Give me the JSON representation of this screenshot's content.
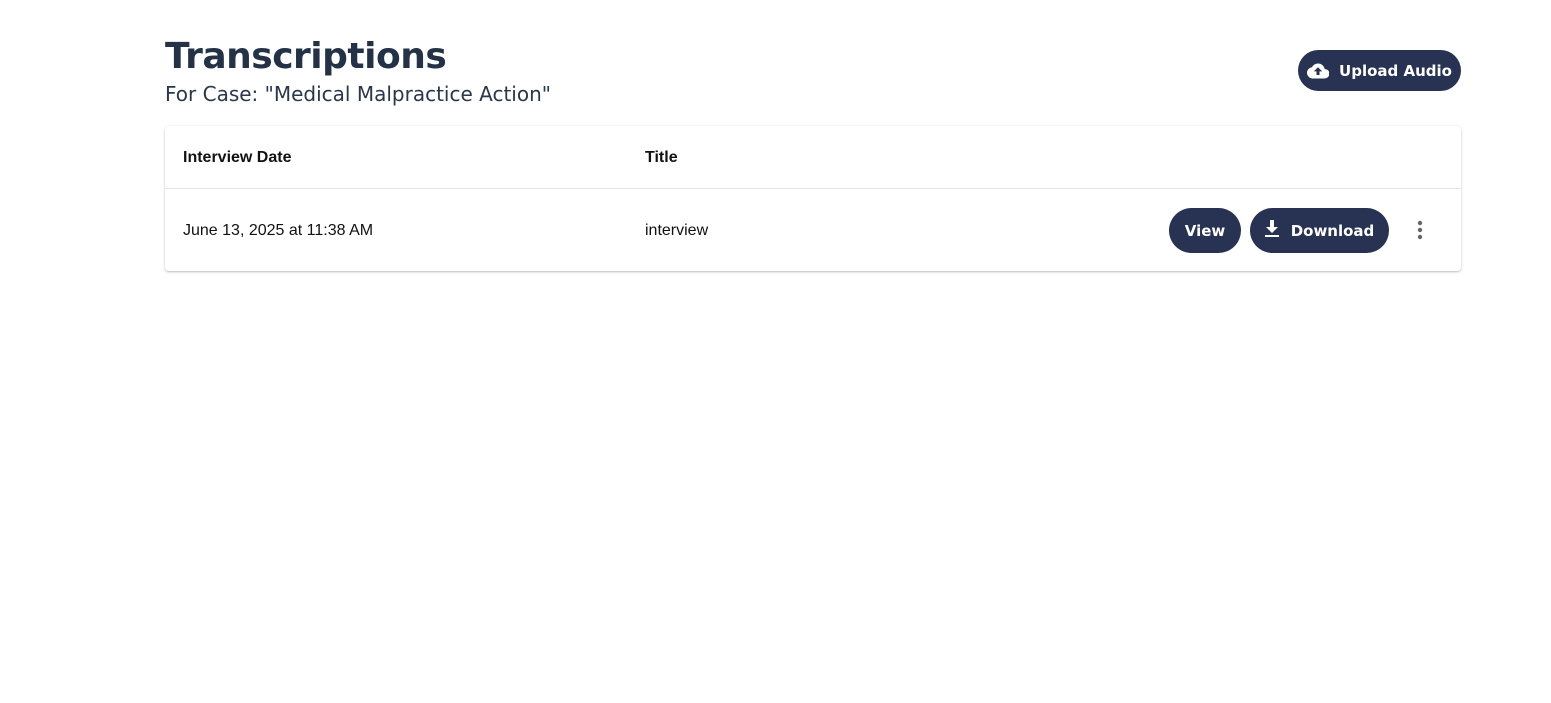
{
  "header": {
    "title": "Transcriptions",
    "subtitle": "For Case: \"Medical Malpractice Action\"",
    "upload_button_label": "Upload Audio",
    "upload_icon": "cloud-upload-icon"
  },
  "table": {
    "columns": [
      "Interview Date",
      "Title"
    ],
    "rows": [
      {
        "interview_date": "June 13, 2025 at 11:38 AM",
        "title": "interview",
        "view_label": "View",
        "download_label": "Download",
        "download_icon": "download-icon",
        "more_icon": "more-vert-icon"
      }
    ]
  },
  "colors": {
    "primary": "#283252",
    "title_text": "#243247",
    "background": "#ffffff"
  }
}
